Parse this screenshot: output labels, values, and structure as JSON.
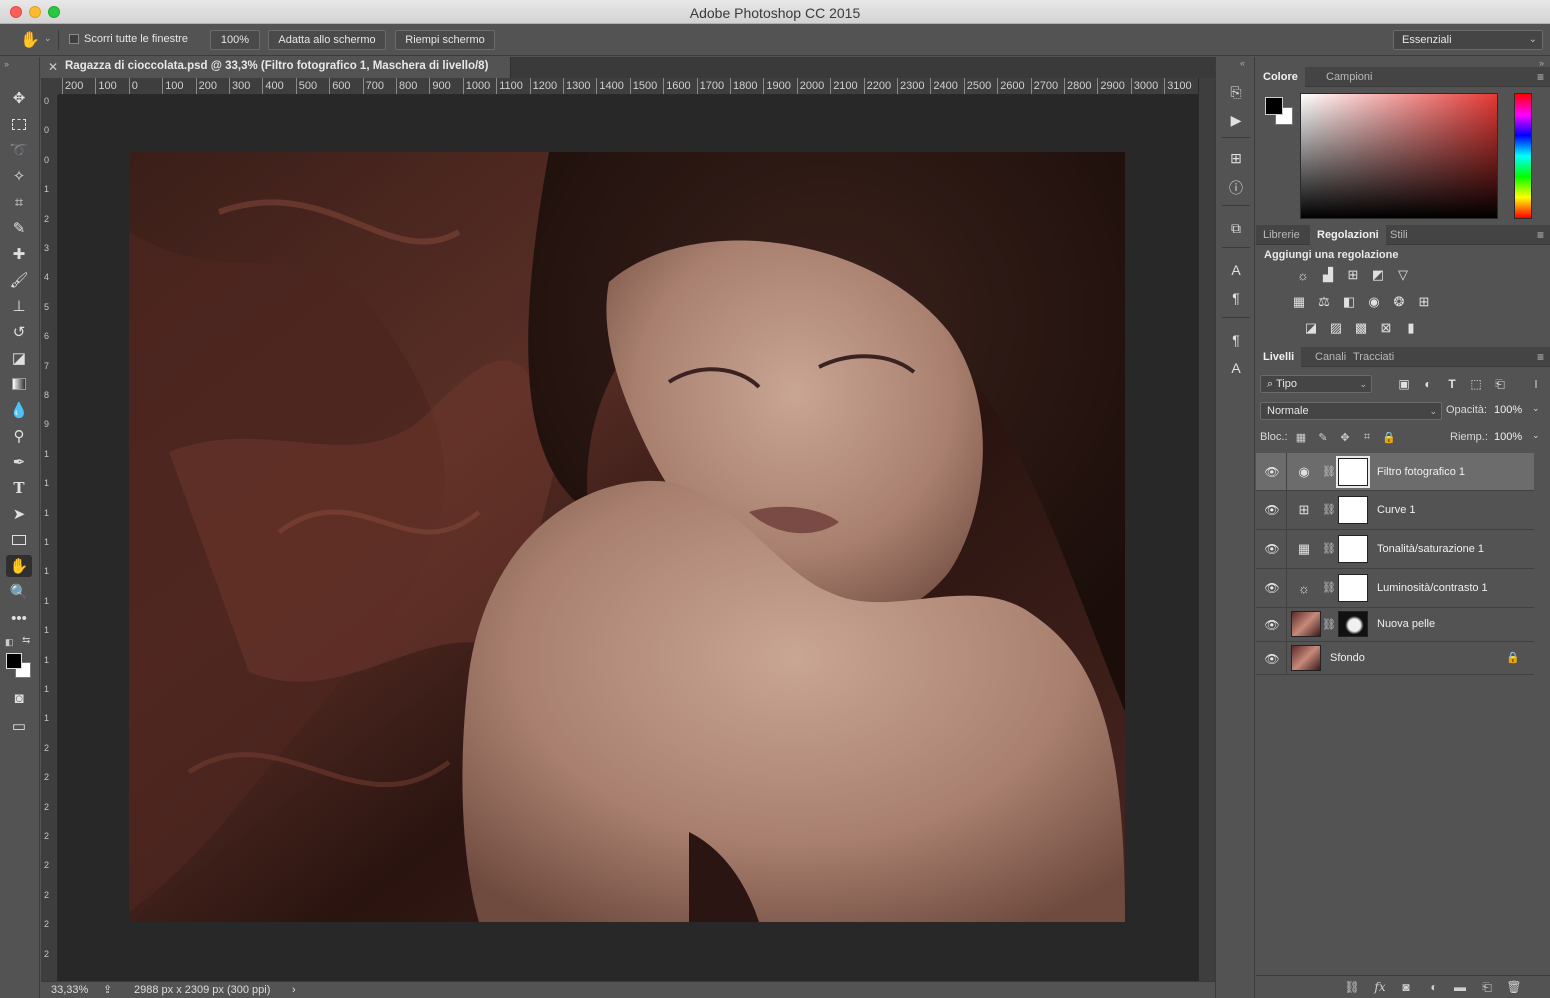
{
  "window": {
    "title": "Adobe Photoshop CC 2015"
  },
  "options_bar": {
    "scroll_all_label": "Scorri tutte le finestre",
    "zoom_button": "100%",
    "fit_screen_button": "Adatta allo schermo",
    "fill_screen_button": "Riempi schermo",
    "workspace": "Essenziali"
  },
  "document": {
    "tab_title": "Ragazza di cioccolata.psd @ 33,3% (Filtro fotografico 1, Maschera di livello/8)",
    "zoom": "33,33%",
    "dimensions": "2988 px x 2309 px (300 ppi)"
  },
  "ruler": {
    "h_ticks": [
      "200",
      "100",
      "0",
      "100",
      "200",
      "300",
      "400",
      "500",
      "600",
      "700",
      "800",
      "900",
      "1000",
      "1100",
      "1200",
      "1300",
      "1400",
      "1500",
      "1600",
      "1700",
      "1800",
      "1900",
      "2000",
      "2100",
      "2200",
      "2300",
      "2400",
      "2500",
      "2600",
      "2700",
      "2800",
      "2900",
      "3000",
      "3100"
    ],
    "v_ticks": [
      "0",
      "0",
      "0",
      "1",
      "2",
      "3",
      "4",
      "5",
      "6",
      "7",
      "8",
      "9",
      "1",
      "1",
      "1",
      "1",
      "1",
      "1",
      "1",
      "1",
      "1",
      "1",
      "2",
      "2",
      "2",
      "2",
      "2",
      "2",
      "2",
      "2"
    ]
  },
  "tools": [
    "move-tool",
    "marquee-tool",
    "lasso-tool",
    "magic-wand-tool",
    "crop-tool",
    "eyedropper-tool",
    "healing-brush-tool",
    "brush-tool",
    "clone-stamp-tool",
    "history-brush-tool",
    "eraser-tool",
    "gradient-tool",
    "blur-tool",
    "dodge-tool",
    "pen-tool",
    "type-tool",
    "path-selection-tool",
    "rectangle-tool",
    "hand-tool",
    "zoom-tool",
    "more-tools"
  ],
  "color_panel": {
    "tabs": [
      "Colore",
      "Campioni"
    ],
    "active_tab": "Colore"
  },
  "adjustments_panel": {
    "tabs": [
      "Librerie",
      "Regolazioni",
      "Stili"
    ],
    "active_tab": "Regolazioni",
    "title": "Aggiungi una regolazione"
  },
  "layers_panel": {
    "tabs": [
      "Livelli",
      "Canali",
      "Tracciati"
    ],
    "active_tab": "Livelli",
    "filter_kind": "Tipo",
    "blend_mode": "Normale",
    "opacity_label": "Opacità:",
    "opacity_value": "100%",
    "lock_label": "Bloc.:",
    "fill_label": "Riemp.:",
    "fill_value": "100%",
    "layers": [
      {
        "name": "Filtro fotografico 1",
        "type": "photo-filter",
        "selected": true
      },
      {
        "name": "Curve 1",
        "type": "curves",
        "selected": false
      },
      {
        "name": "Tonalità/saturazione 1",
        "type": "hue-saturation",
        "selected": false
      },
      {
        "name": "Luminosità/contrasto 1",
        "type": "brightness-contrast",
        "selected": false
      },
      {
        "name": "Nuova pelle",
        "type": "image-with-mask",
        "selected": false
      },
      {
        "name": "Sfondo",
        "type": "background",
        "selected": false
      }
    ]
  },
  "colors": {
    "ui_background": "#535353",
    "canvas_background": "#282828",
    "foreground": "#000000",
    "background": "#ffffff"
  }
}
